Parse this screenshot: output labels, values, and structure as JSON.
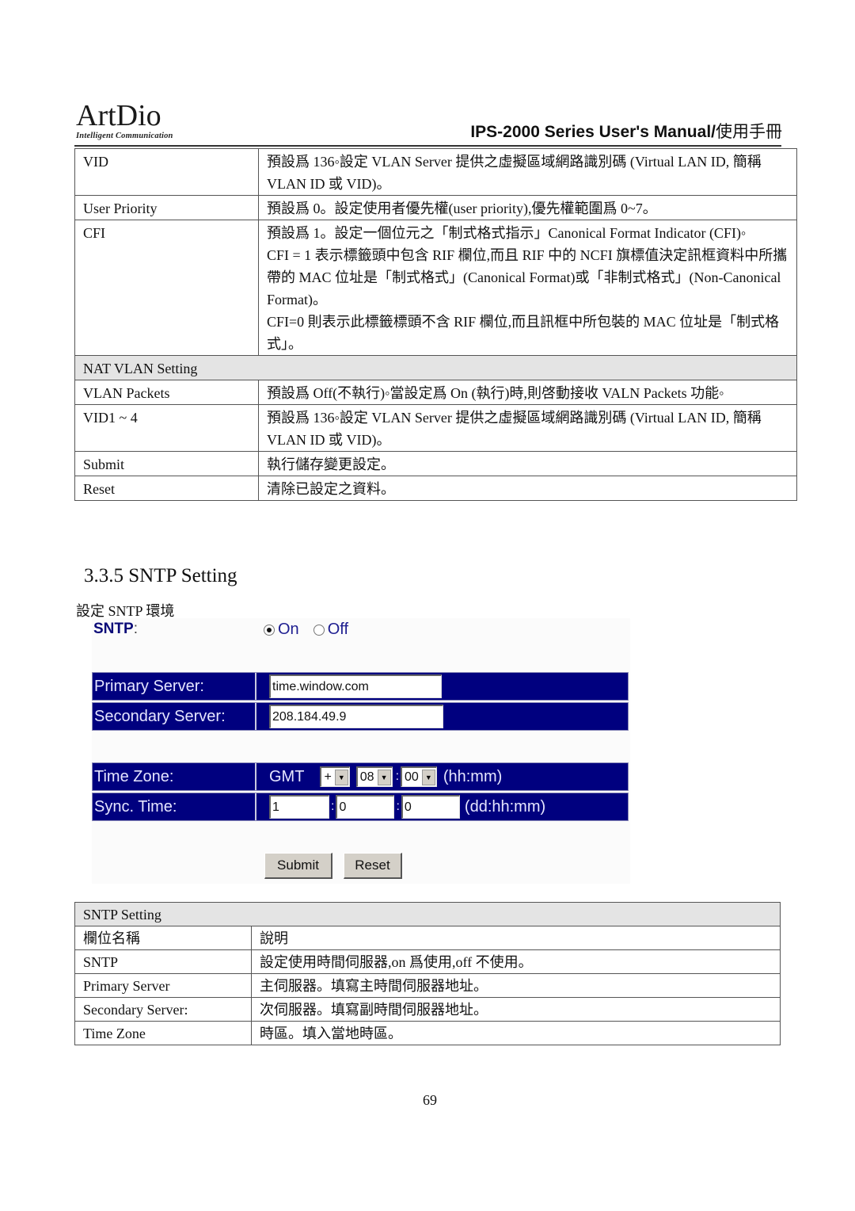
{
  "header": {
    "logo_text": "ArtDio",
    "logo_tagline": "Intelligent Communication",
    "manual_title": "IPS-2000 Series User's Manual/",
    "manual_title_cjk": "使用手冊"
  },
  "vlan_table": {
    "rows": [
      {
        "key": "VID",
        "value": "預設爲 136◦設定 VLAN Server 提供之虛擬區域網路識別碼 (Virtual LAN ID, 簡稱 VLAN ID 或 VID)。"
      },
      {
        "key": "User Priority",
        "value": "預設爲 0。設定使用者優先權(user priority),優先權範圍爲 0~7。"
      },
      {
        "key": "CFI",
        "value_lines": [
          "預設爲 1。設定一個位元之「制式格式指示」Canonical Format Indicator (CFI)◦",
          "CFI = 1 表示標籤頭中包含 RIF 欄位,而且 RIF 中的 NCFI 旗標值決定訊框資料中所攜帶的 MAC 位址是「制式格式」(Canonical Format)或「非制式格式」(Non-Canonical Format)。",
          "CFI=0 則表示此標籤標頭不含 RIF 欄位,而且訊框中所包裝的 MAC 位址是「制式格式」。"
        ]
      }
    ],
    "section_title": "NAT VLAN Setting",
    "section_rows": [
      {
        "key": "VLAN Packets",
        "value": "預設爲 Off(不執行)◦當設定爲 On (執行)時,則啓動接收 VALN Packets 功能◦"
      },
      {
        "key": "VID1 ~ 4",
        "value": "預設爲 136◦設定 VLAN Server 提供之虛擬區域網路識別碼 (Virtual LAN ID, 簡稱 VLAN ID 或 VID)。"
      },
      {
        "key": "Submit",
        "value": "執行儲存變更設定。"
      },
      {
        "key": "Reset",
        "value": "清除已設定之資料。"
      }
    ]
  },
  "section": {
    "heading": "3.3.5 SNTP Setting",
    "subheading": "設定 SNTP 環境"
  },
  "sntp_form": {
    "sntp_label": "SNTP",
    "sntp_options": [
      "On",
      "Off"
    ],
    "sntp_selected": "On",
    "primary_label": "Primary Server:",
    "primary_value": "time.window.com",
    "secondary_label": "Secondary Server:",
    "secondary_value": "208.184.49.9",
    "timezone_label": "Time Zone:",
    "timezone_prefix": "GMT",
    "timezone_sign": "+",
    "timezone_hour": "08",
    "timezone_min": "00",
    "timezone_unit": "(hh:mm)",
    "sync_label": "Sync. Time:",
    "sync_dd": "1",
    "sync_hh": "0",
    "sync_mm": "0",
    "sync_unit": "(dd:hh:mm)",
    "submit_label": "Submit",
    "reset_label": "Reset",
    "colors": {
      "band": "#00007f",
      "label_text": "#0a0a78"
    }
  },
  "sntp_table": {
    "section_title": "SNTP Setting",
    "header": {
      "key": "欄位名稱",
      "value": "說明"
    },
    "rows": [
      {
        "key": "SNTP",
        "value": "設定使用時間伺服器,on 爲使用,off 不使用。"
      },
      {
        "key": "Primary Server",
        "value": "主伺服器。填寫主時間伺服器地址。"
      },
      {
        "key": "Secondary Server:",
        "value": "次伺服器。填寫副時間伺服器地址。"
      },
      {
        "key": "Time Zone",
        "value": "時區。填入當地時區。"
      }
    ]
  },
  "footer": {
    "page_number": "69"
  }
}
